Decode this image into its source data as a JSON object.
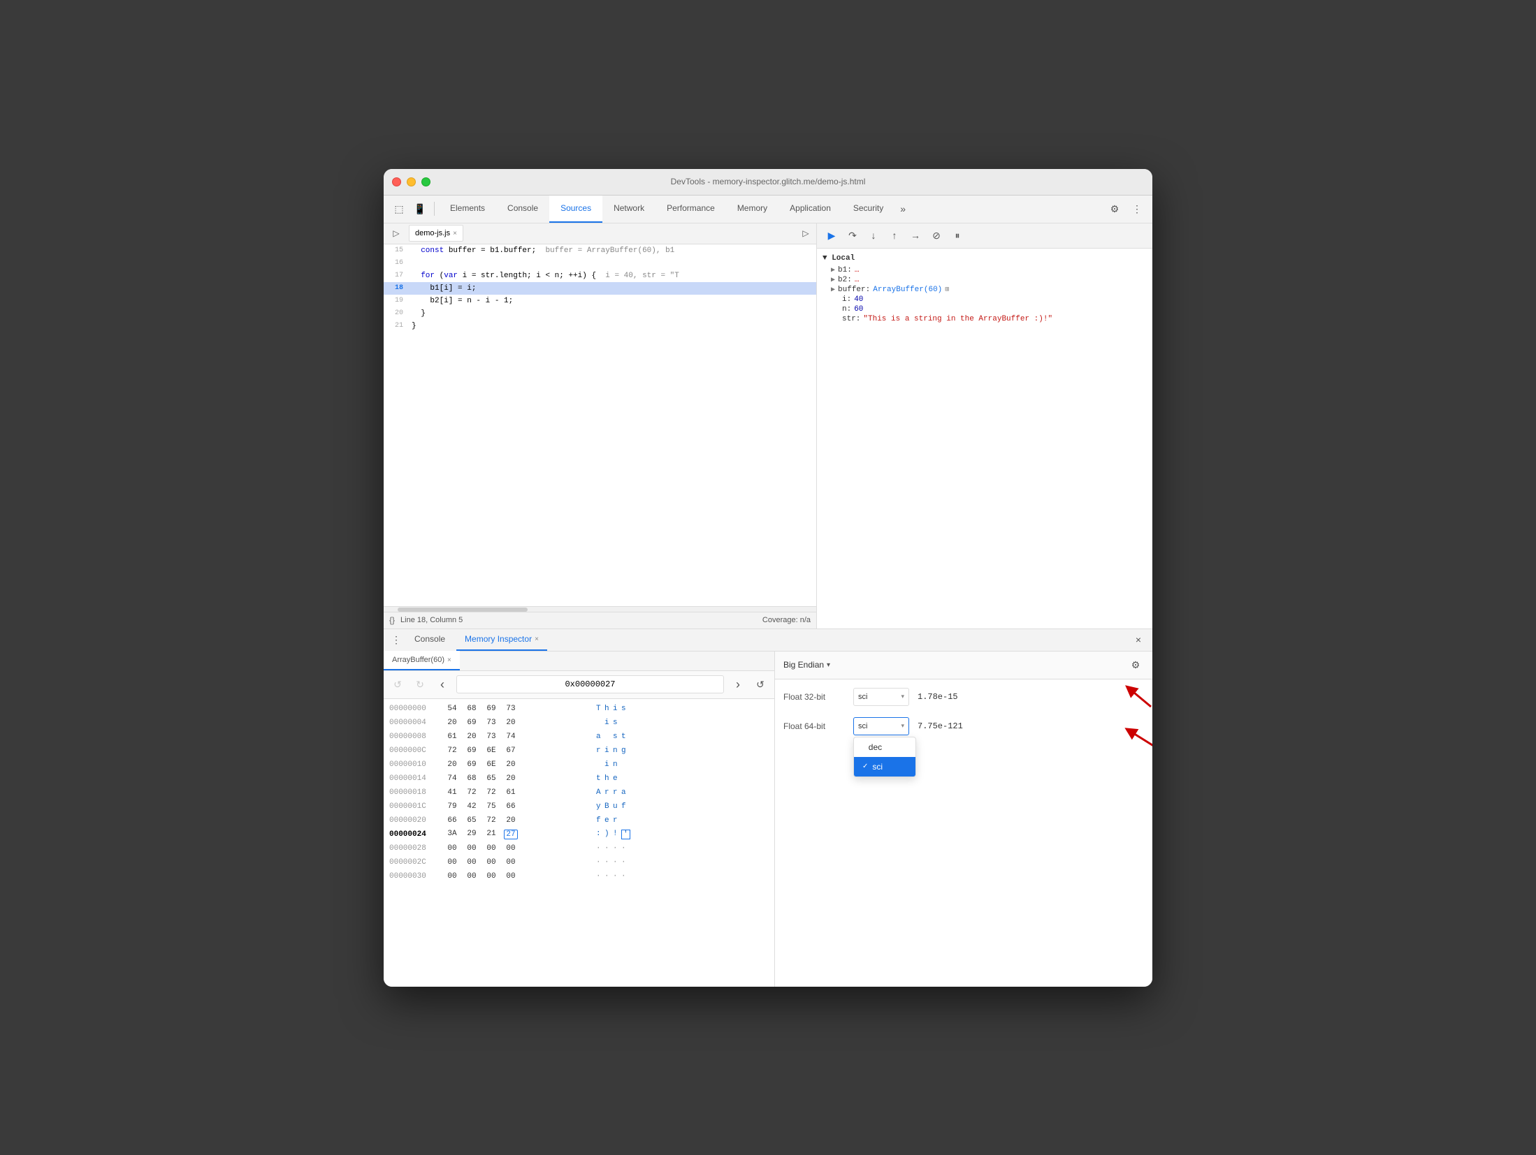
{
  "window": {
    "title": "DevTools - memory-inspector.glitch.me/demo-js.html"
  },
  "toolbar": {
    "tabs": [
      "Elements",
      "Console",
      "Sources",
      "Network",
      "Performance",
      "Memory",
      "Application",
      "Security"
    ],
    "active_tab": "Sources"
  },
  "source": {
    "filename": "demo-js.js",
    "lines": [
      {
        "num": "15",
        "content": "  const buffer = b1.buffer;  buffer = ArrayBuffer(60), b1",
        "highlighted": false,
        "active": false
      },
      {
        "num": "16",
        "content": "",
        "highlighted": false,
        "active": false
      },
      {
        "num": "17",
        "content": "  for (var i = str.length; i < n; ++i) {  i = 40, str = \"T",
        "highlighted": false,
        "active": false
      },
      {
        "num": "18",
        "content": "    b1[i] = i;",
        "highlighted": false,
        "active": true
      },
      {
        "num": "19",
        "content": "    b2[i] = n - i - 1;",
        "highlighted": false,
        "active": false
      },
      {
        "num": "20",
        "content": "  }",
        "highlighted": false,
        "active": false
      },
      {
        "num": "21",
        "content": "}",
        "highlighted": false,
        "active": false
      }
    ],
    "status": "Line 18, Column 5",
    "coverage": "Coverage: n/a"
  },
  "debugger": {
    "scope_label": "Local",
    "variables": [
      {
        "key": "b1:",
        "val": "…",
        "type": "expand"
      },
      {
        "key": "b2:",
        "val": "…",
        "type": "expand"
      },
      {
        "key": "buffer:",
        "val": "ArrayBuffer(60)",
        "type": "memory"
      },
      {
        "key": "i:",
        "val": "40",
        "type": "num"
      },
      {
        "key": "n:",
        "val": "60",
        "type": "num"
      },
      {
        "key": "str:",
        "val": "\"This is a string in the ArrayBuffer :)!\"",
        "type": "str"
      }
    ]
  },
  "bottom_tabs": {
    "console_label": "Console",
    "memory_inspector_label": "Memory Inspector"
  },
  "memory": {
    "buffer_label": "ArrayBuffer(60)",
    "address": "0x00000027",
    "rows": [
      {
        "addr": "00000000",
        "bytes": [
          "54",
          "68",
          "69",
          "73"
        ],
        "chars": [
          "T",
          "h",
          "i",
          "s"
        ],
        "bold": false
      },
      {
        "addr": "00000004",
        "bytes": [
          "20",
          "69",
          "73",
          "20"
        ],
        "chars": [
          " ",
          "i",
          "s",
          " "
        ],
        "bold": false
      },
      {
        "addr": "00000008",
        "bytes": [
          "61",
          "20",
          "73",
          "74"
        ],
        "chars": [
          "a",
          " ",
          "s",
          "t"
        ],
        "bold": false
      },
      {
        "addr": "0000000C",
        "bytes": [
          "72",
          "69",
          "6E",
          "67"
        ],
        "chars": [
          "r",
          "i",
          "n",
          "g"
        ],
        "bold": false
      },
      {
        "addr": "00000010",
        "bytes": [
          "20",
          "69",
          "6E",
          "20"
        ],
        "chars": [
          " ",
          "i",
          "n",
          " "
        ],
        "bold": false
      },
      {
        "addr": "00000014",
        "bytes": [
          "74",
          "68",
          "65",
          "20"
        ],
        "chars": [
          "t",
          "h",
          "e",
          " "
        ],
        "bold": false
      },
      {
        "addr": "00000018",
        "bytes": [
          "41",
          "72",
          "72",
          "61"
        ],
        "chars": [
          "A",
          "r",
          "r",
          "a"
        ],
        "bold": false
      },
      {
        "addr": "0000001C",
        "bytes": [
          "79",
          "42",
          "75",
          "66"
        ],
        "chars": [
          "y",
          "B",
          "u",
          "f"
        ],
        "bold": false
      },
      {
        "addr": "00000020",
        "bytes": [
          "66",
          "65",
          "72",
          "20"
        ],
        "chars": [
          "f",
          "e",
          "r",
          " "
        ],
        "bold": false
      },
      {
        "addr": "00000024",
        "bytes": [
          "3A",
          "29",
          "21",
          "27"
        ],
        "chars": [
          ":",
          " )",
          "!",
          "'"
        ],
        "bold": true,
        "highlight_idx": 3
      },
      {
        "addr": "00000028",
        "bytes": [
          "00",
          "00",
          "00",
          "00"
        ],
        "chars": [
          "·",
          "·",
          "·",
          "·"
        ],
        "bold": false
      },
      {
        "addr": "0000002C",
        "bytes": [
          "00",
          "00",
          "00",
          "00"
        ],
        "chars": [
          "·",
          "·",
          "·",
          "·"
        ],
        "bold": false
      },
      {
        "addr": "00000030",
        "bytes": [
          "00",
          "00",
          "00",
          "00"
        ],
        "chars": [
          "·",
          "·",
          "·",
          "·"
        ],
        "bold": false
      }
    ]
  },
  "inspector": {
    "endian_label": "Big Endian",
    "float32": {
      "label": "Float 32-bit",
      "format": "sci",
      "value": "1.78e-15"
    },
    "float64": {
      "label": "Float 64-bit",
      "format": "sci",
      "value": "7.75e-121",
      "dropdown_open": true
    },
    "dropdown_options": [
      {
        "label": "dec",
        "selected": false
      },
      {
        "label": "sci",
        "selected": true
      }
    ]
  },
  "icons": {
    "back": "↺",
    "forward": "↻",
    "left_arrow": "‹",
    "right_arrow": "›",
    "refresh": "↺",
    "gear": "⚙",
    "close": "×",
    "play": "▶",
    "pause": "⏸",
    "step_over": "↷",
    "step_into": "↓",
    "step_out": "↑",
    "resume": "⏭",
    "breakpoints": "⊘",
    "more_tabs": "»",
    "element_picker": "⬚",
    "device_toolbar": "📱",
    "three_dots": "⋮"
  }
}
